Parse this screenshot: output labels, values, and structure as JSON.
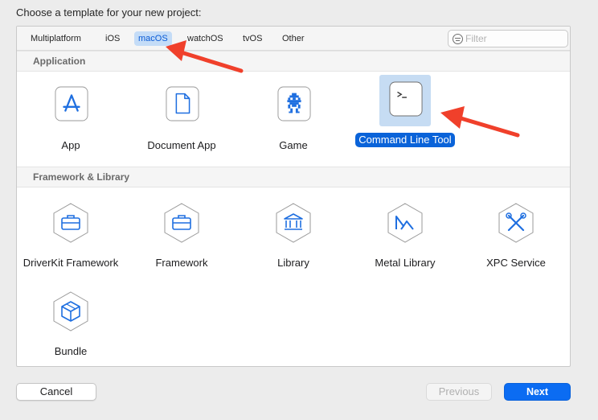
{
  "dialog": {
    "heading": "Choose a template for your new project:"
  },
  "tabs": [
    {
      "label": "Multiplatform",
      "selected": false
    },
    {
      "label": "iOS",
      "selected": false
    },
    {
      "label": "macOS",
      "selected": true
    },
    {
      "label": "watchOS",
      "selected": false
    },
    {
      "label": "tvOS",
      "selected": false
    },
    {
      "label": "Other",
      "selected": false
    }
  ],
  "filter": {
    "placeholder": "Filter",
    "value": "",
    "icon": "filter-icon"
  },
  "sections": [
    {
      "title": "Application",
      "items": [
        {
          "label": "App",
          "icon": "app-store-icon",
          "selected": false
        },
        {
          "label": "Document App",
          "icon": "document-icon",
          "selected": false
        },
        {
          "label": "Game",
          "icon": "game-icon",
          "selected": false
        },
        {
          "label": "Command Line Tool",
          "icon": "terminal-icon",
          "selected": true
        }
      ]
    },
    {
      "title": "Framework & Library",
      "items": [
        {
          "label": "DriverKit Framework",
          "icon": "toolbox-icon",
          "selected": false
        },
        {
          "label": "Framework",
          "icon": "toolbox-icon",
          "selected": false
        },
        {
          "label": "Library",
          "icon": "library-icon",
          "selected": false
        },
        {
          "label": "Metal Library",
          "icon": "metal-icon",
          "selected": false
        },
        {
          "label": "XPC Service",
          "icon": "tools-icon",
          "selected": false
        },
        {
          "label": "Bundle",
          "icon": "bundle-icon",
          "selected": false
        }
      ]
    }
  ],
  "buttons": {
    "cancel": "Cancel",
    "previous": "Previous",
    "next": "Next"
  },
  "colors": {
    "accent": "#0b6cf2",
    "selection": "#c6dcf3",
    "annotation_arrow": "#f0402b"
  }
}
